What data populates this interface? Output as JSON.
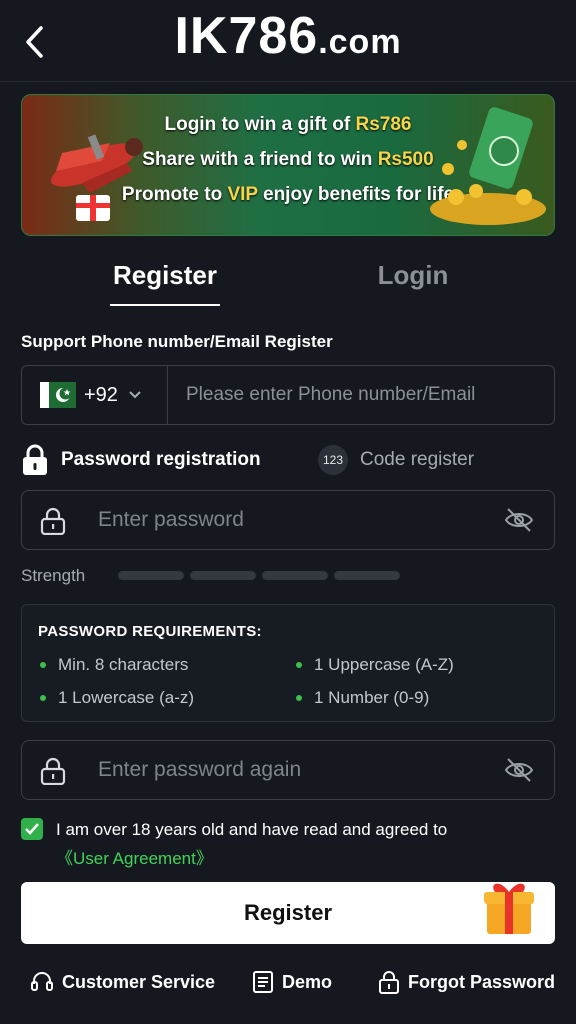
{
  "header": {
    "brand_main": "IK786",
    "brand_suffix": ".com"
  },
  "banner": {
    "line1_prefix": "Login to win a gift of ",
    "line1_highlight": "Rs786",
    "line2_prefix": "Share with a friend to win ",
    "line2_highlight": "Rs500",
    "line3_prefix": "Promote to ",
    "line3_highlight": "VIP",
    "line3_suffix": " enjoy benefits for life"
  },
  "tabs": [
    {
      "label": "Register",
      "active": true
    },
    {
      "label": "Login",
      "active": false
    }
  ],
  "form": {
    "support_label": "Support Phone number/Email Register",
    "country_code": "+92",
    "phone_placeholder": "Please enter Phone number/Email",
    "mode_password": "Password registration",
    "mode_code_badge": "123",
    "mode_code": "Code register",
    "password_placeholder": "Enter password",
    "strength_label": "Strength",
    "requirements_title": "PASSWORD REQUIREMENTS:",
    "requirements": [
      "Min. 8 characters",
      "1 Uppercase (A-Z)",
      "1 Lowercase (a-z)",
      "1 Number (0-9)"
    ],
    "password_again_placeholder": "Enter password again",
    "agree_text": "I am over 18 years old and have read and agreed to",
    "agree_link": "《User Agreement》",
    "agree_checked": true,
    "submit_label": "Register"
  },
  "footer": {
    "customer_service": "Customer Service",
    "demo": "Demo",
    "forgot_password": "Forgot Password"
  },
  "colors": {
    "background": "#15191f",
    "accent_green": "#3fd35a",
    "highlight_gold": "#f7d54a"
  }
}
